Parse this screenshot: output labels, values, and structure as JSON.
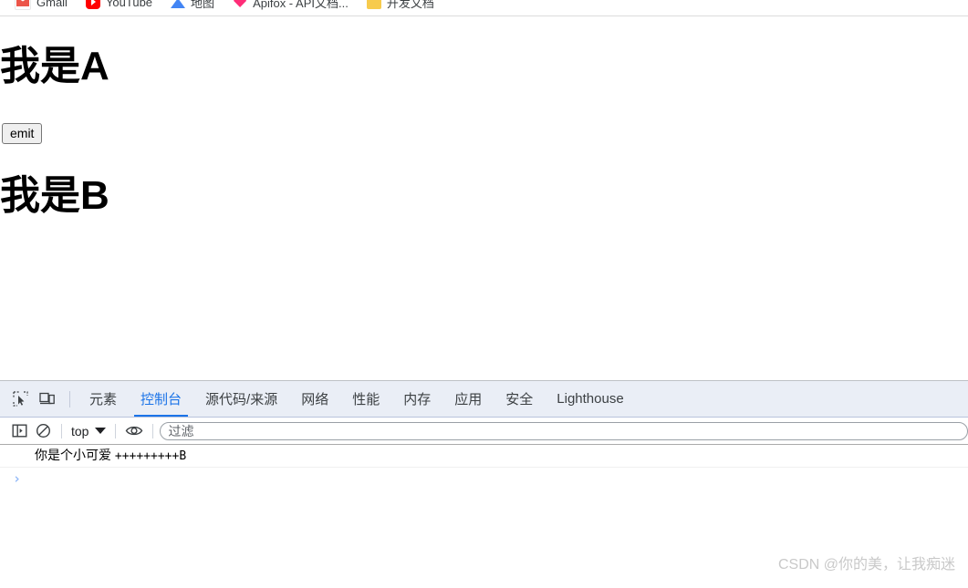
{
  "browser": {
    "bookmarks": [
      {
        "label": "Gmail",
        "icon": "gmail-icon"
      },
      {
        "label": "YouTube",
        "icon": "youtube-icon"
      },
      {
        "label": "地图",
        "icon": "maps-icon"
      },
      {
        "label": "Apifox - API文档...",
        "icon": "apifox-icon"
      },
      {
        "label": "开发文档",
        "icon": "folder-icon"
      }
    ]
  },
  "page": {
    "heading_a": "我是A",
    "heading_b": "我是B",
    "emit_button": "emit"
  },
  "devtools": {
    "toolbar_icons": [
      {
        "name": "inspect-element-icon",
        "title": "检查"
      },
      {
        "name": "device-toolbar-icon",
        "title": "设备工具栏"
      }
    ],
    "tabs": [
      {
        "label": "元素",
        "active": false
      },
      {
        "label": "控制台",
        "active": true
      },
      {
        "label": "源代码/来源",
        "active": false
      },
      {
        "label": "网络",
        "active": false
      },
      {
        "label": "性能",
        "active": false
      },
      {
        "label": "内存",
        "active": false
      },
      {
        "label": "应用",
        "active": false
      },
      {
        "label": "安全",
        "active": false
      },
      {
        "label": "Lighthouse",
        "active": false
      }
    ],
    "console_toolbar": {
      "sidebar_toggle": "console-sidebar-icon",
      "clear_console": "clear-console-icon",
      "context_label": "top",
      "eye_icon": "live-expression-icon",
      "filter_placeholder": "过滤",
      "filter_value": ""
    },
    "console_messages": [
      {
        "text": "你是个小可爱 ",
        "suffix": "+++++++++B"
      }
    ],
    "prompt_symbol": "›"
  },
  "watermark": {
    "text": "CSDN @你的美，让我痴迷"
  },
  "colors": {
    "accent": "#1a73e8",
    "tabbar_bg": "#eaeef6",
    "console_text": "#000000"
  }
}
